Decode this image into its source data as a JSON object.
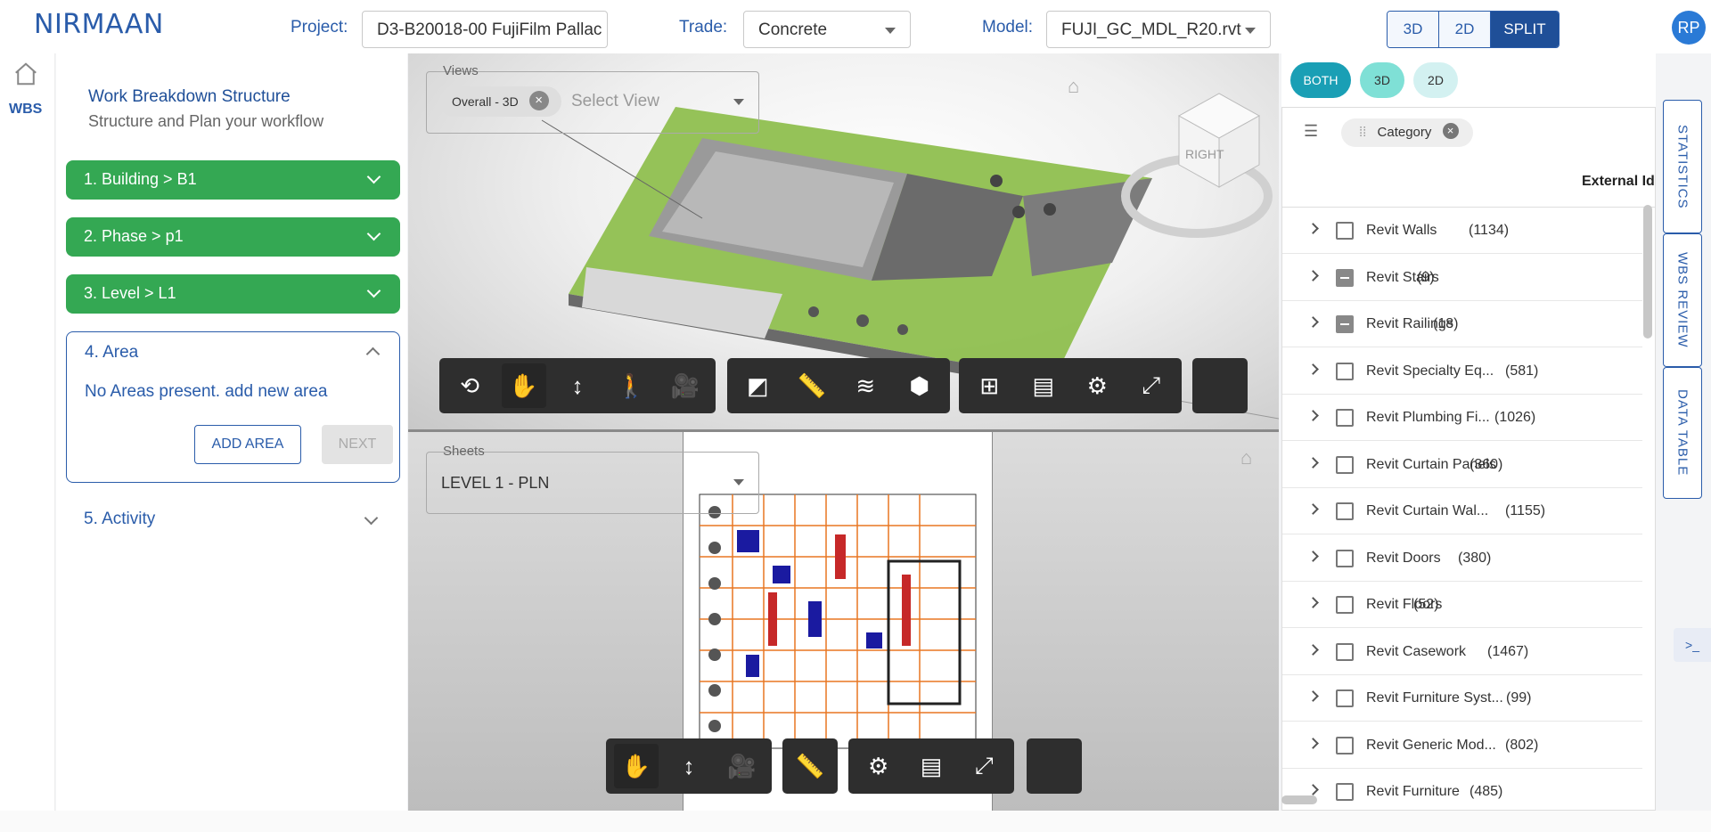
{
  "app": {
    "logo": "NIRMAAN",
    "avatar": "RP"
  },
  "header": {
    "project_label": "Project:",
    "project_value": "D3-B20018-00 FujiFilm Pallac",
    "trade_label": "Trade:",
    "trade_value": "Concrete",
    "model_label": "Model:",
    "model_value": "FUJI_GC_MDL_R20.rvt",
    "view_modes": [
      "3D",
      "2D",
      "SPLIT"
    ],
    "active_view_mode": "SPLIT"
  },
  "rail": {
    "wbs_label": "WBS"
  },
  "wbs": {
    "title": "Work Breakdown Structure",
    "subtitle": "Structure and Plan your workflow",
    "steps": [
      {
        "label": "1. Building > B1"
      },
      {
        "label": "2. Phase > p1"
      },
      {
        "label": "3. Level > L1"
      }
    ],
    "area": {
      "title": "4. Area",
      "message": "No Areas present. add new area",
      "add_button": "ADD AREA",
      "next_button": "NEXT"
    },
    "activity": "5. Activity"
  },
  "viewer3d": {
    "views_legend": "Views",
    "selected_view": "Overall - 3D",
    "placeholder": "Select View",
    "viewcube_label": "RIGHT"
  },
  "viewer2d": {
    "sheets_legend": "Sheets",
    "selected_sheet": "LEVEL 1 - PLN"
  },
  "filters": {
    "buttons": [
      "BOTH",
      "3D",
      "2D"
    ],
    "active": "BOTH"
  },
  "datatable": {
    "group_chip": "Category",
    "column_header": "External Id",
    "rows": [
      {
        "label": "Revit Walls",
        "count": "(1134)",
        "state": "unchecked"
      },
      {
        "label": "Revit Stairs",
        "count": "(9)",
        "state": "indeterminate"
      },
      {
        "label": "Revit Railings",
        "count": "(18)",
        "state": "indeterminate"
      },
      {
        "label": "Revit Specialty Eq...",
        "count": "(581)",
        "state": "unchecked"
      },
      {
        "label": "Revit Plumbing Fi...",
        "count": "(1026)",
        "state": "unchecked"
      },
      {
        "label": "Revit Curtain Panels",
        "count": "(360)",
        "state": "unchecked"
      },
      {
        "label": "Revit Curtain Wal...",
        "count": "(1155)",
        "state": "unchecked"
      },
      {
        "label": "Revit Doors",
        "count": "(380)",
        "state": "unchecked"
      },
      {
        "label": "Revit Floors",
        "count": "(52)",
        "state": "unchecked"
      },
      {
        "label": "Revit Casework",
        "count": "(1467)",
        "state": "unchecked"
      },
      {
        "label": "Revit Furniture Syst...",
        "count": "(99)",
        "state": "unchecked"
      },
      {
        "label": "Revit Generic Mod...",
        "count": "(802)",
        "state": "unchecked"
      },
      {
        "label": "Revit Furniture",
        "count": "(485)",
        "state": "unchecked"
      }
    ]
  },
  "side_tabs": [
    "STATISTICS",
    "WBS REVIEW",
    "DATA TABLE"
  ],
  "colors": {
    "brand": "#2a5caa",
    "step_green": "#34a853",
    "accent_blue": "#1ea7ff",
    "both_teal": "#1a9fb5"
  }
}
